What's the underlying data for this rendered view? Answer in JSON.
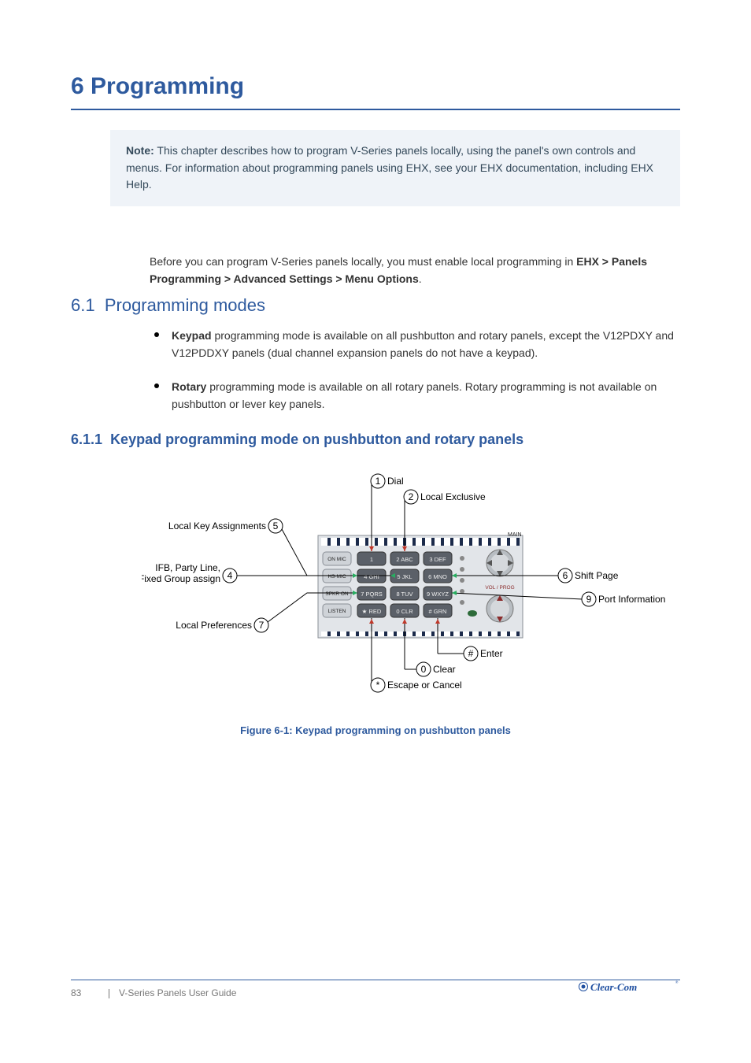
{
  "header": {
    "title": "Programming"
  },
  "note": {
    "label": "Note:",
    "body": "This chapter describes how to program V-Series panels locally, using the panel's own controls and menus. For information about programming panels using EHX, see your EHX documentation, including EHX Help."
  },
  "intro": {
    "text_before_bold": "Before you can program V-Series panels locally, you must enable local programming in ",
    "bold1": "EHX > Panels Programming > Advanced Settings > Menu Options",
    "text_after_bold": "."
  },
  "modes_heading_no": "6.1",
  "modes_heading": "Programming modes",
  "modes": {
    "items": [
      {
        "bold": "Keypad",
        "rest": " programming mode is available on all pushbutton and rotary panels, except the V12PDXY and V12PDDXY panels (dual channel expansion panels do not have a keypad)."
      },
      {
        "bold": "Rotary",
        "rest": " programming mode is available on all rotary panels. Rotary programming is not available on pushbutton or lever key panels."
      }
    ]
  },
  "keypad_heading_no": "6.1.1",
  "keypad_heading": "Keypad programming mode on pushbutton and rotary panels",
  "fig": {
    "caption": "Figure 6-1: Keypad programming on pushbutton panels",
    "callouts": {
      "dial": {
        "no": "1",
        "text": "Dial"
      },
      "local_exclusive": {
        "no": "2",
        "text": "Local Exclusive"
      },
      "local_key": {
        "no": "5",
        "text": "Local Key Assignments"
      },
      "ifb": {
        "no": "4",
        "text": "IFB, Party Line, Fixed Group assign"
      },
      "local_pref": {
        "no": "7",
        "text": "Local Preferences"
      },
      "shift_page": {
        "no": "6",
        "text": "Shift Page"
      },
      "port_info": {
        "no": "9",
        "text": "Port Information"
      },
      "enter": {
        "no": "#",
        "text": "Enter"
      },
      "clear": {
        "no": "0",
        "text": "Clear"
      },
      "escape": {
        "no": "*",
        "text": "Escape or Cancel"
      }
    },
    "keypad": {
      "rows": [
        [
          "ON MIC",
          "1",
          "2 ABC",
          "3 DEF"
        ],
        [
          "HS-MIC",
          "4 GHI",
          "5 JKL",
          "6 MNO"
        ],
        [
          "SPKR ON",
          "7 PQRS",
          "8 TUV",
          "9 WXYZ"
        ],
        [
          "LISTEN",
          "★ RED",
          "0 CLR",
          "# GRN"
        ]
      ],
      "right_labels": {
        "main": "MAIN",
        "volprog": "VOL / PROG"
      }
    }
  },
  "footer": {
    "page": "83",
    "doc": "V-Series Panels User Guide"
  },
  "brand": {
    "name": "Clear-Com"
  }
}
